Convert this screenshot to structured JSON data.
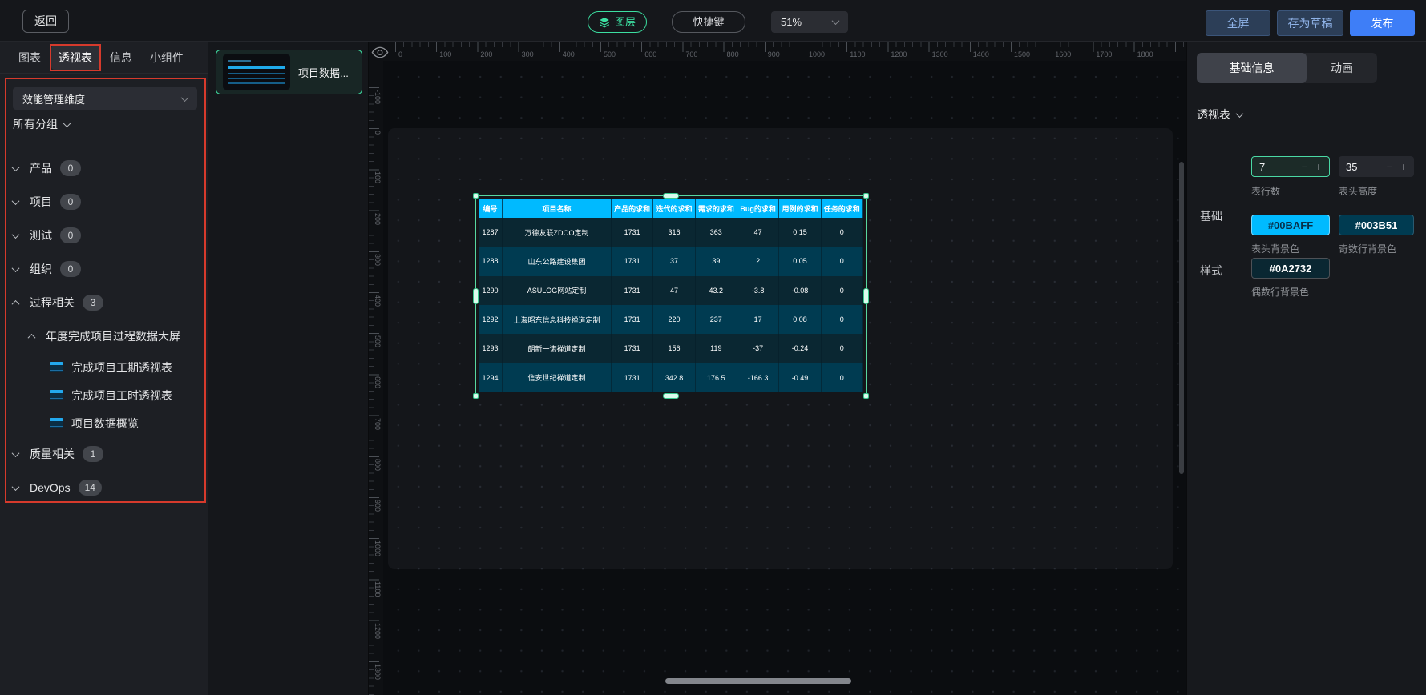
{
  "topbar": {
    "back": "返回",
    "layers_button": "图层",
    "shortcut_button": "快捷键",
    "zoom_value": "51%",
    "fullscreen": "全屏",
    "save_draft": "存为草稿",
    "publish": "发布"
  },
  "left_panel": {
    "tabs": [
      {
        "label": "图表",
        "active": false
      },
      {
        "label": "透视表",
        "active": true
      },
      {
        "label": "信息",
        "active": false
      },
      {
        "label": "小组件",
        "active": false
      }
    ],
    "dimension_select": "效能管理维度",
    "group_filter": "所有分组",
    "tree": [
      {
        "label": "产品",
        "badge": "0",
        "expanded": false,
        "level": 0
      },
      {
        "label": "项目",
        "badge": "0",
        "expanded": false,
        "level": 0
      },
      {
        "label": "测试",
        "badge": "0",
        "expanded": false,
        "level": 0
      },
      {
        "label": "组织",
        "badge": "0",
        "expanded": false,
        "level": 0
      },
      {
        "label": "过程相关",
        "badge": "3",
        "expanded": true,
        "level": 0
      },
      {
        "label": "年度完成项目过程数据大屏",
        "expanded": true,
        "level": 1
      },
      {
        "label": "完成项目工期透视表",
        "level": 2,
        "type": "pivot-table"
      },
      {
        "label": "完成项目工时透视表",
        "level": 2,
        "type": "pivot-table"
      },
      {
        "label": "项目数据概览",
        "level": 2,
        "type": "pivot-table"
      },
      {
        "label": "质量相关",
        "badge": "1",
        "expanded": false,
        "level": 0
      },
      {
        "label": "DevOps",
        "badge": "14",
        "expanded": false,
        "level": 0
      }
    ]
  },
  "layers_panel": {
    "items": [
      {
        "label": "项目数据...",
        "selected": true
      }
    ]
  },
  "canvas": {
    "h_ruler": [
      "0",
      "100",
      "200",
      "300",
      "400",
      "500",
      "600",
      "700",
      "800",
      "900",
      "1000",
      "1100",
      "1200",
      "1300",
      "1400",
      "1500",
      "1600",
      "1700",
      "1800"
    ],
    "v_ruler": [
      "-100",
      "0",
      "100",
      "200",
      "300",
      "400",
      "500",
      "600",
      "700",
      "800",
      "900",
      "1000",
      "1100",
      "1200",
      "1300"
    ],
    "table": {
      "headers": [
        "编号",
        "项目名称",
        "产品的求和",
        "迭代的求和",
        "需求的求和",
        "Bug的求和",
        "用例的求和",
        "任务的求和"
      ],
      "rows": [
        [
          "1287",
          "万德友联ZDOO定制",
          "1731",
          "316",
          "363",
          "47",
          "0.15",
          "0"
        ],
        [
          "1288",
          "山东公路建设集团",
          "1731",
          "37",
          "39",
          "2",
          "0.05",
          "0"
        ],
        [
          "1290",
          "ASULOG网站定制",
          "1731",
          "47",
          "43.2",
          "-3.8",
          "-0.08",
          "0"
        ],
        [
          "1292",
          "上海昭东信息科技禅道定制",
          "1731",
          "220",
          "237",
          "17",
          "0.08",
          "0"
        ],
        [
          "1293",
          "朗新一诺禅道定制",
          "1731",
          "156",
          "119",
          "-37",
          "-0.24",
          "0"
        ],
        [
          "1294",
          "信安世纪禅道定制",
          "1731",
          "342.8",
          "176.5",
          "-166.3",
          "-0.49",
          "0"
        ]
      ],
      "colors": {
        "header_bg": "#00BAFF",
        "odd_row_bg": "#003B51",
        "even_row_bg": "#0A2732"
      }
    }
  },
  "right_panel": {
    "tabs": [
      {
        "label": "基础信息",
        "active": true
      },
      {
        "label": "动画",
        "active": false
      }
    ],
    "component_title": "透视表",
    "basic_section": {
      "label": "基础",
      "rows_count": {
        "value": "7",
        "label": "表行数"
      },
      "header_height": {
        "value": "35",
        "label": "表头高度"
      }
    },
    "style_section": {
      "label": "样式",
      "colors": [
        {
          "value": "#00BAFF",
          "label": "表头背景色"
        },
        {
          "value": "#003B51",
          "label": "奇数行背景色"
        },
        {
          "value": "#0A2732",
          "label": "偶数行背景色"
        }
      ]
    }
  }
}
